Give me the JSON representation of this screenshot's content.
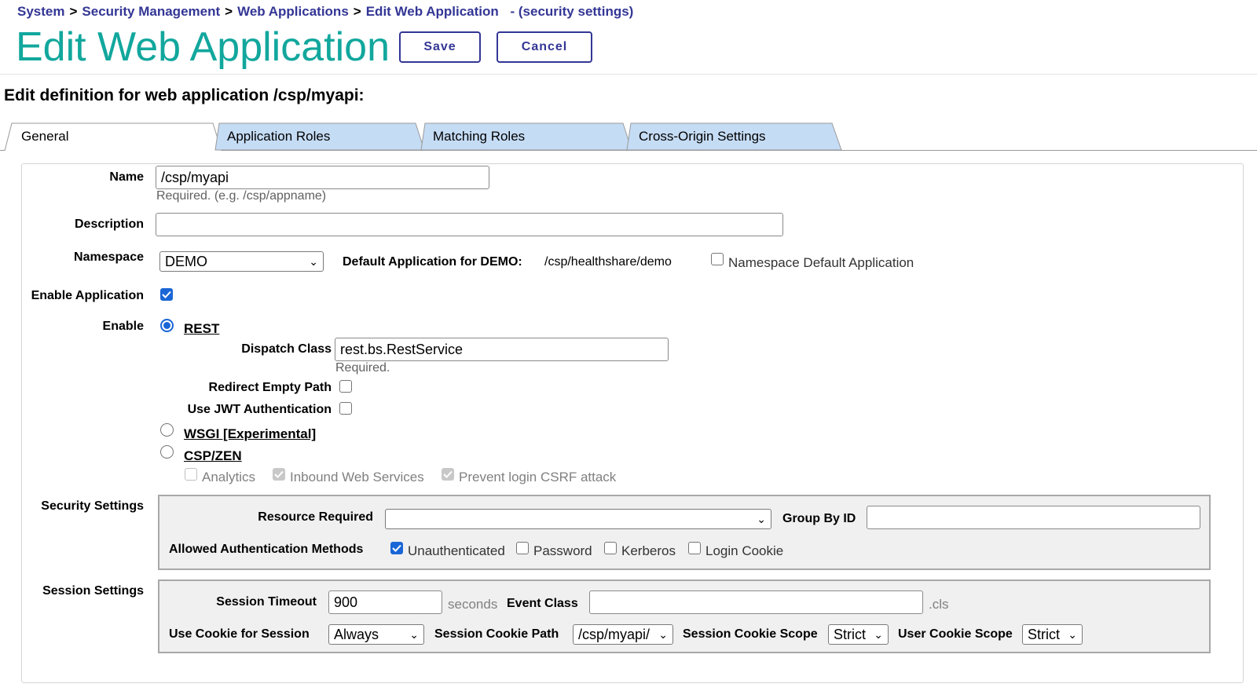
{
  "breadcrumb": {
    "items": [
      "System",
      "Security Management",
      "Web Applications",
      "Edit Web Application"
    ],
    "separator": ">",
    "suffix": "- (security settings)"
  },
  "header": {
    "title": "Edit Web Application",
    "save_label": "Save",
    "cancel_label": "Cancel"
  },
  "subtitle": "Edit definition for web application /csp/myapi:",
  "tabs": [
    {
      "label": "General",
      "active": true
    },
    {
      "label": "Application Roles",
      "active": false
    },
    {
      "label": "Matching Roles",
      "active": false
    },
    {
      "label": "Cross-Origin Settings",
      "active": false
    }
  ],
  "form": {
    "name": {
      "label": "Name",
      "value": "/csp/myapi",
      "hint": "Required. (e.g. /csp/appname)"
    },
    "description": {
      "label": "Description",
      "value": ""
    },
    "namespace": {
      "label": "Namespace",
      "value": "DEMO",
      "default_label": "Default Application for DEMO:",
      "default_value": "/csp/healthshare/demo",
      "ns_default_app_label": "Namespace Default Application",
      "ns_default_app_checked": false
    },
    "enable_application": {
      "label": "Enable Application",
      "checked": true
    },
    "enable": {
      "label": "Enable",
      "rest": {
        "label": "REST",
        "selected": true
      },
      "dispatch_class": {
        "label": "Dispatch Class",
        "value": "rest.bs.RestService",
        "hint": "Required."
      },
      "redirect_empty_path": {
        "label": "Redirect Empty Path",
        "checked": false
      },
      "use_jwt": {
        "label": "Use JWT Authentication",
        "checked": false
      },
      "wsgi": {
        "label": "WSGI [Experimental]",
        "selected": false
      },
      "csp_zen": {
        "label": "CSP/ZEN",
        "selected": false
      },
      "analytics": {
        "label": "Analytics",
        "checked": false
      },
      "inbound_web_services": {
        "label": "Inbound Web Services",
        "checked": true
      },
      "prevent_csrf": {
        "label": "Prevent login CSRF attack",
        "checked": true
      }
    },
    "security": {
      "label": "Security Settings",
      "resource_required_label": "Resource Required",
      "resource_required_value": "",
      "group_by_id_label": "Group By ID",
      "group_by_id_value": "",
      "auth_methods_label": "Allowed Authentication Methods",
      "unauthenticated": {
        "label": "Unauthenticated",
        "checked": true
      },
      "password": {
        "label": "Password",
        "checked": false
      },
      "kerberos": {
        "label": "Kerberos",
        "checked": false
      },
      "login_cookie": {
        "label": "Login Cookie",
        "checked": false
      }
    },
    "session": {
      "label": "Session Settings",
      "timeout_label": "Session Timeout",
      "timeout_value": "900",
      "timeout_unit": "seconds",
      "event_class_label": "Event Class",
      "event_class_value": "",
      "event_class_suffix": ".cls",
      "use_cookie_label": "Use Cookie for Session",
      "use_cookie_value": "Always",
      "cookie_path_label": "Session Cookie Path",
      "cookie_path_value": "/csp/myapi/",
      "cookie_scope_label": "Session Cookie Scope",
      "cookie_scope_value": "Strict",
      "user_cookie_scope_label": "User Cookie Scope",
      "user_cookie_scope_value": "Strict"
    }
  },
  "colors": {
    "title": "#12a79d",
    "link": "#333695",
    "tab_inactive": "#c5dcf5",
    "checkbox_checked": "#1a66d6"
  }
}
